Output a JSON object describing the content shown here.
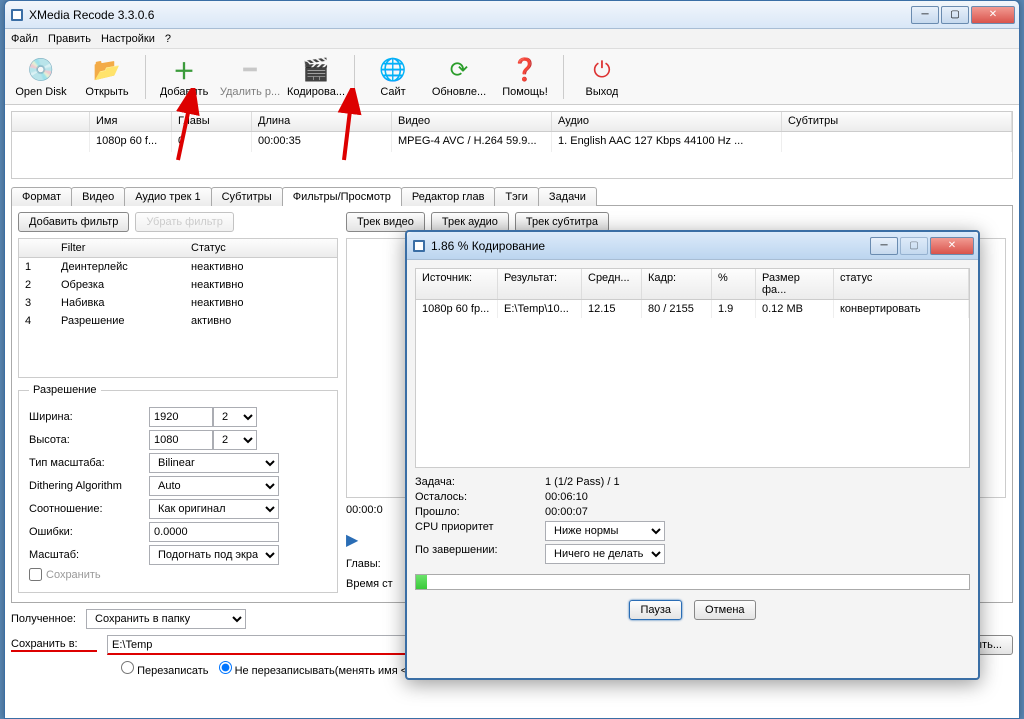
{
  "app": {
    "title": "XMedia Recode 3.3.0.6"
  },
  "menu": {
    "file": "Файл",
    "edit": "Править",
    "settings": "Настройки",
    "help": "?"
  },
  "toolbar": {
    "opendisk": "Open Disk",
    "open": "Открыть",
    "add": "Добавить",
    "remove": "Удалить р...",
    "encode": "Кодирова...",
    "site": "Сайт",
    "update": "Обновле...",
    "help": "Помощь!",
    "exit": "Выход"
  },
  "fileTable": {
    "cols": {
      "name": "Имя",
      "chapters": "Главы",
      "length": "Длина",
      "video": "Видео",
      "audio": "Аудио",
      "subtitles": "Субтитры"
    },
    "row": {
      "name": "1080p 60 f...",
      "chapters": "0",
      "length": "00:00:35",
      "video": "MPEG-4 AVC / H.264 59.9...",
      "audio": "1. English AAC  127 Kbps 44100 Hz ...",
      "subtitles": ""
    }
  },
  "tabs": {
    "format": "Формат",
    "video": "Видео",
    "audio": "Аудио трек 1",
    "subtitles": "Субтитры",
    "filters": "Фильтры/Просмотр",
    "chapters": "Редактор глав",
    "tags": "Тэги",
    "tasks": "Задачи"
  },
  "filterBtns": {
    "add": "Добавить фильтр",
    "remove": "Убрать фильтр"
  },
  "trackBtns": {
    "video": "Трек видео",
    "audio": "Трек аудио",
    "sub": "Трек субтитра"
  },
  "filterTable": {
    "cols": {
      "filter": "Filter",
      "status": "Статус"
    },
    "rows": [
      {
        "n": "1",
        "name": "Деинтерлейс",
        "status": "неактивно"
      },
      {
        "n": "2",
        "name": "Обрезка",
        "status": "неактивно"
      },
      {
        "n": "3",
        "name": "Набивка",
        "status": "неактивно"
      },
      {
        "n": "4",
        "name": "Разрешение",
        "status": "активно"
      }
    ]
  },
  "resolution": {
    "legend": "Разрешение",
    "widthLbl": "Ширина:",
    "width": "1920",
    "wMult": "2",
    "heightLbl": "Высота:",
    "height": "1080",
    "hMult": "2",
    "scaleTypeLbl": "Тип масштаба:",
    "scaleType": "Bilinear",
    "ditherLbl": "Dithering Algorithm",
    "dither": "Auto",
    "ratioLbl": "Соотношение:",
    "ratio": "Как оригинал",
    "errorsLbl": "Ошибки:",
    "errors": "0.0000",
    "zoomLbl": "Масштаб:",
    "zoom": "Подогнать под экран",
    "saveCrop": "Сохранить"
  },
  "preview": {
    "time": "00:00:0",
    "chapters": "Главы:",
    "runtime": "Время ст"
  },
  "output": {
    "resultLbl": "Полученное:",
    "result": "Сохранить в папку",
    "saveLbl": "Сохранить в:",
    "path": "E:\\Temp",
    "overwrite": "Перезаписать",
    "noOverwrite": "Не перезаписывать(менять имя <filename + index>)",
    "browse": "Открыть..."
  },
  "modal": {
    "title": "1.86 % Кодирование",
    "cols": {
      "src": "Источник:",
      "dst": "Результат:",
      "avg": "Средн...",
      "frame": "Кадр:",
      "pct": "%",
      "size": "Размер фа...",
      "status": "статус"
    },
    "row": {
      "src": "1080p 60 fp...",
      "dst": "E:\\Temp\\10...",
      "avg": "12.15",
      "frame": "80 / 2155",
      "pct": "1.9",
      "size": "0.12 MB",
      "status": "конвертировать"
    },
    "stats": {
      "taskLbl": "Задача:",
      "task": "1 (1/2 Pass) / 1",
      "remainLbl": "Осталось:",
      "remain": "00:06:10",
      "elapsedLbl": "Прошло:",
      "elapsed": "00:00:07",
      "cpuLbl": "CPU приоритет",
      "cpu": "Ниже нормы",
      "afterLbl": "По завершении:",
      "after": "Ничего не делать"
    },
    "btns": {
      "pause": "Пауза",
      "cancel": "Отмена"
    }
  }
}
